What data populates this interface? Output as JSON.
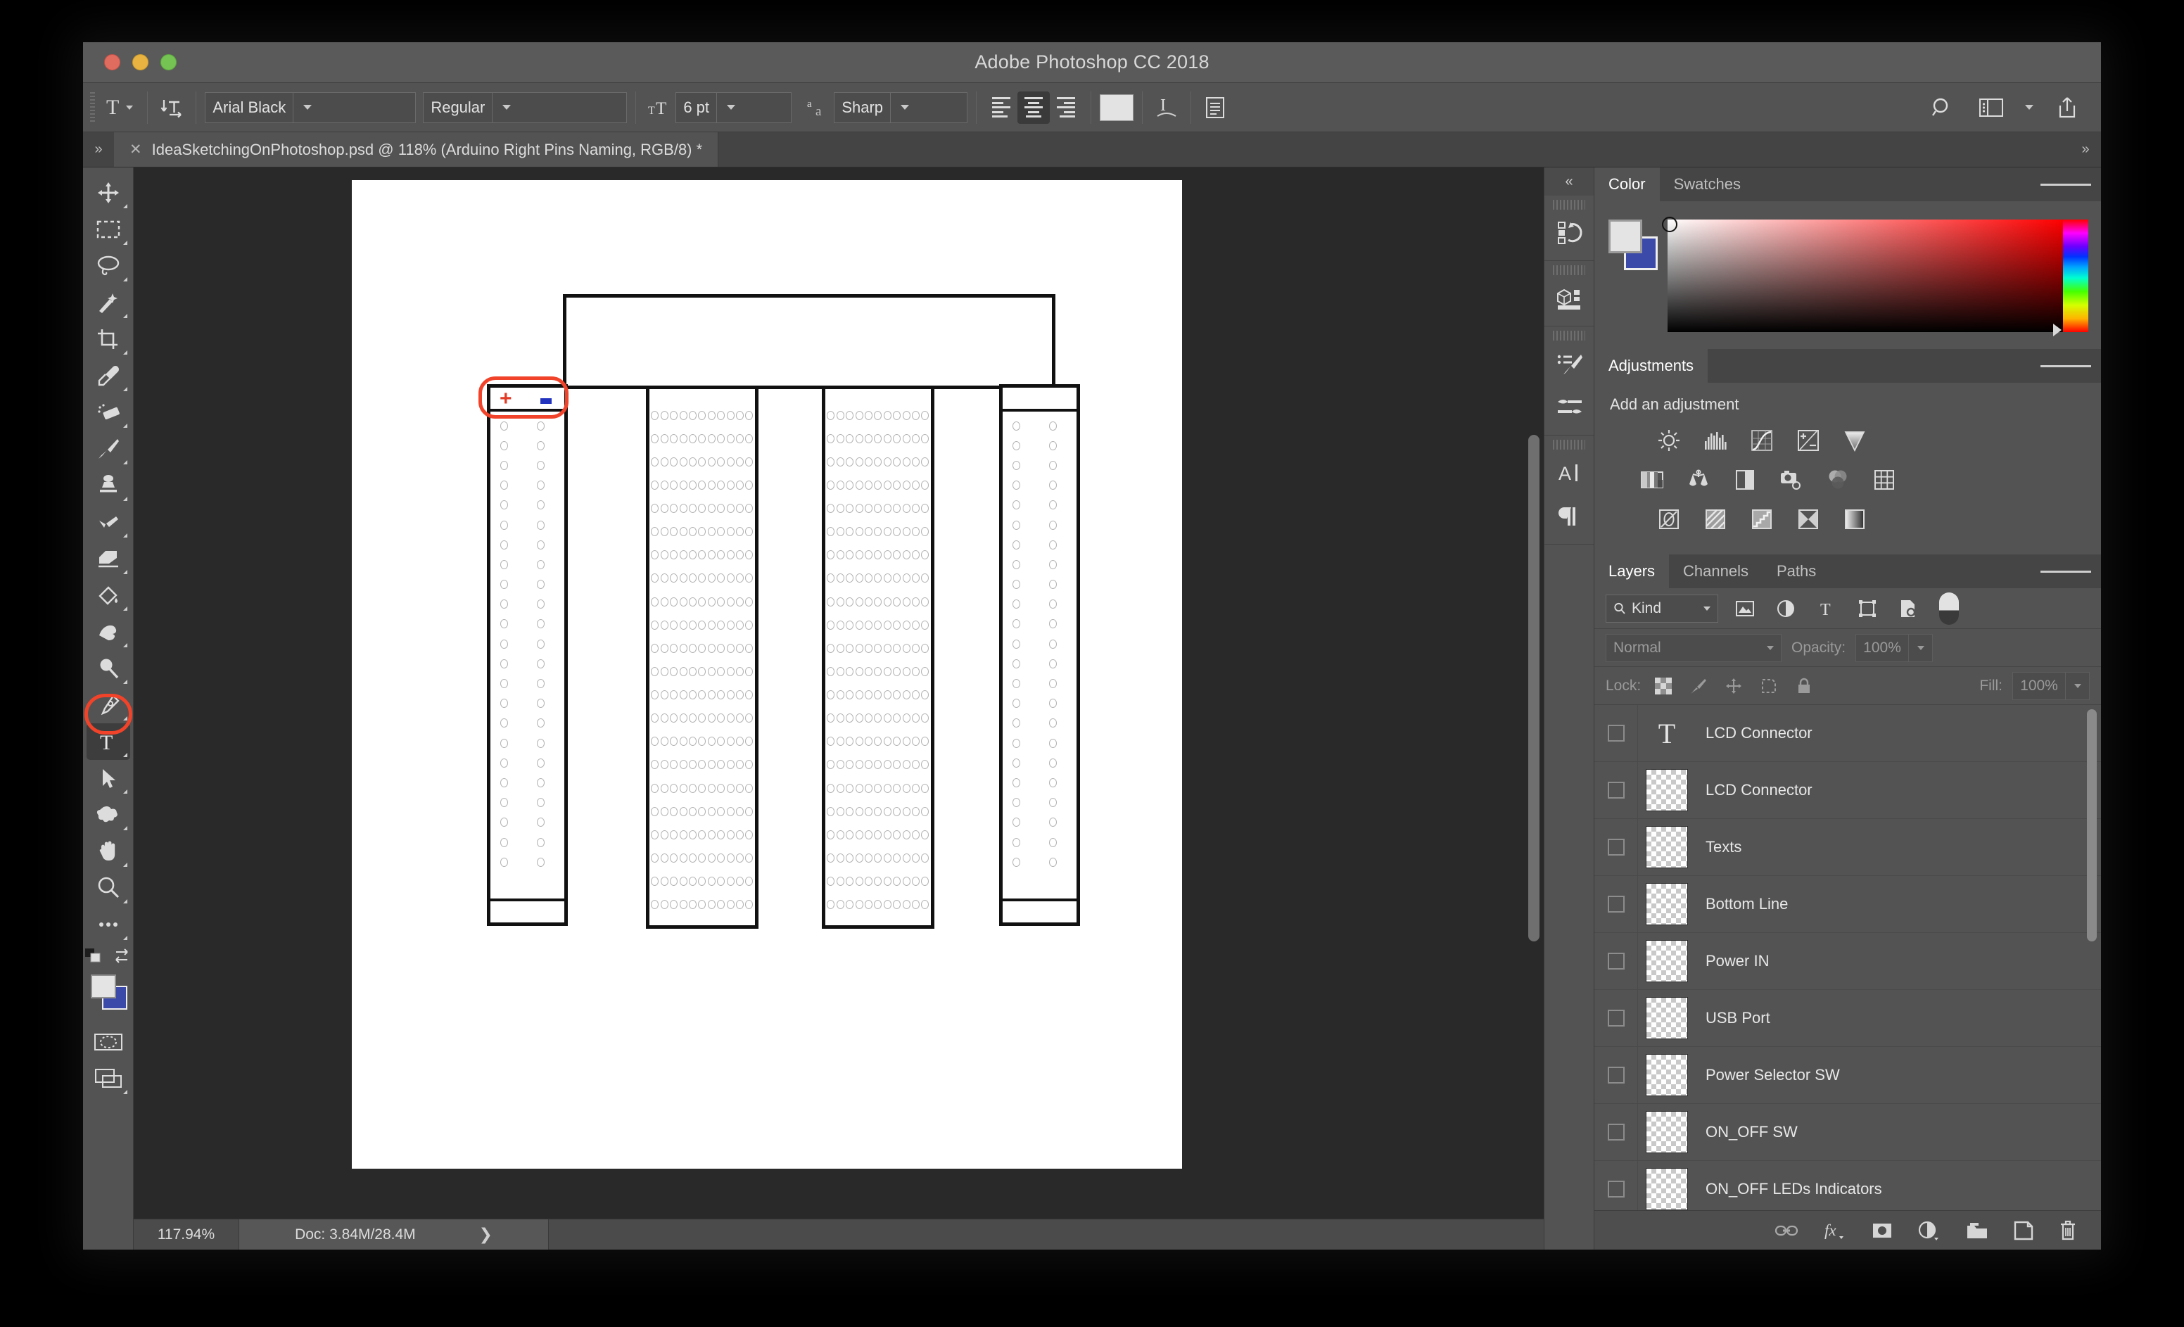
{
  "window": {
    "title": "Adobe Photoshop CC 2018",
    "traffic_lights": [
      "close",
      "minimize",
      "zoom"
    ]
  },
  "options_bar": {
    "tool_preset_icon": "text-tool-icon",
    "orientation_icon": "toggle-text-orientation-icon",
    "font_family": "Arial Black",
    "font_style": "Regular",
    "size_icon": "font-size-icon",
    "font_size": "6 pt",
    "antialias_icon": "anti-alias-icon",
    "antialias": "Sharp",
    "align_left_icon": "align-left-icon",
    "align_center_icon": "align-center-icon",
    "align_right_icon": "align-right-icon",
    "align_active": "center",
    "color_swatch": "#e3e3e3",
    "warp_icon": "warp-text-icon",
    "panel_icon": "character-paragraph-panel-icon",
    "search_icon": "search-icon",
    "workspace_icon": "workspace-switcher-icon",
    "workspace_caret_icon": "chevron-down-icon",
    "share_icon": "share-icon"
  },
  "tab_bar": {
    "collapse_icon": "expand-arrows-icon",
    "close_icon": "close-icon",
    "document_title": "IdeaSketchingOnPhotoshop.psd @ 118% (Arduino Right Pins Naming, RGB/8) *",
    "right_collapse_icon": "expand-arrows-icon"
  },
  "tools": [
    {
      "name": "move-tool",
      "icon": "move-icon",
      "selected": false
    },
    {
      "name": "rectangular-marquee-tool",
      "icon": "marquee-icon",
      "selected": false
    },
    {
      "name": "lasso-tool",
      "icon": "lasso-icon",
      "selected": false
    },
    {
      "name": "quick-selection-tool",
      "icon": "magic-wand-icon",
      "selected": false
    },
    {
      "name": "crop-tool",
      "icon": "crop-icon",
      "selected": false
    },
    {
      "name": "eyedropper-tool",
      "icon": "eyedropper-icon",
      "selected": false
    },
    {
      "name": "spot-healing-brush-tool",
      "icon": "healing-brush-icon",
      "selected": false
    },
    {
      "name": "brush-tool",
      "icon": "brush-icon",
      "selected": false
    },
    {
      "name": "clone-stamp-tool",
      "icon": "clone-stamp-icon",
      "selected": false
    },
    {
      "name": "history-brush-tool",
      "icon": "history-brush-icon",
      "selected": false
    },
    {
      "name": "eraser-tool",
      "icon": "eraser-icon",
      "selected": false
    },
    {
      "name": "gradient-tool",
      "icon": "paint-bucket-icon",
      "selected": false
    },
    {
      "name": "blur-tool",
      "icon": "blur-finger-icon",
      "selected": false
    },
    {
      "name": "dodge-tool",
      "icon": "dodge-icon",
      "selected": false
    },
    {
      "name": "pen-tool",
      "icon": "pen-icon",
      "selected": false
    },
    {
      "name": "type-tool",
      "icon": "text-tool-icon",
      "selected": true
    },
    {
      "name": "path-selection-tool",
      "icon": "path-arrow-icon",
      "selected": false
    },
    {
      "name": "shape-tool",
      "icon": "custom-shape-icon",
      "selected": false
    },
    {
      "name": "hand-tool",
      "icon": "hand-icon",
      "selected": false
    },
    {
      "name": "zoom-tool",
      "icon": "magnifier-icon",
      "selected": false
    },
    {
      "name": "edit-toolbar-button",
      "icon": "ellipsis-icon",
      "selected": false
    }
  ],
  "tool_footer": {
    "default_colors_icon": "default-colors-icon",
    "swap_colors_icon": "swap-colors-icon",
    "foreground_color": "#e4e4e4",
    "background_color": "#3b49a8",
    "quick_mask_icon": "quick-mask-icon",
    "screen_mode_icon": "screen-mode-icon"
  },
  "canvas": {
    "drawing": "arduino-breadboard-sketch",
    "plus_label": "+",
    "minus_label": "-",
    "highlight_color": "#f0432a",
    "plus_color": "#e23b26",
    "minus_color": "#2233c0",
    "vertical_scrollbar": "canvas-vertical-scrollbar",
    "horizontal_scrollbar": "canvas-horizontal-scrollbar"
  },
  "status_bar": {
    "zoom": "117.94%",
    "doc_info": "Doc: 3.84M/28.4M",
    "expand_icon": "chevron-right-icon"
  },
  "dock_rail": {
    "collapse_icon": "double-chevron-left-icon",
    "groups": [
      {
        "icons": [
          {
            "name": "history-panel-icon"
          }
        ]
      },
      {
        "icons": [
          {
            "name": "3d-panel-icon"
          }
        ]
      },
      {
        "icons": [
          {
            "name": "brush-presets-panel-icon"
          },
          {
            "name": "brush-settings-panel-icon"
          }
        ]
      },
      {
        "icons": [
          {
            "name": "character-panel-icon"
          },
          {
            "name": "paragraph-panel-icon"
          }
        ]
      }
    ]
  },
  "color_panel": {
    "tabs": [
      {
        "label": "Color",
        "active": true
      },
      {
        "label": "Swatches",
        "active": false
      }
    ],
    "menu_icon": "panel-menu-icon",
    "foreground_color": "#e4e4e4",
    "background_color": "#3b49a8",
    "picker_icon": "color-field",
    "hue_icon": "hue-slider"
  },
  "adjustments_panel": {
    "tabs": [
      {
        "label": "Adjustments",
        "active": true
      }
    ],
    "menu_icon": "panel-menu-icon",
    "heading": "Add an adjustment",
    "rows": [
      [
        "brightness-contrast-icon",
        "levels-icon",
        "curves-icon",
        "exposure-icon",
        "vibrance-icon"
      ],
      [
        "hue-saturation-icon",
        "color-balance-icon",
        "black-white-icon",
        "photo-filter-icon",
        "channel-mixer-icon",
        "color-lookup-icon"
      ],
      [
        "invert-icon",
        "posterize-icon",
        "threshold-icon",
        "gradient-map-icon",
        "selective-color-icon"
      ]
    ]
  },
  "layers_panel": {
    "tabs": [
      {
        "label": "Layers",
        "active": true
      },
      {
        "label": "Channels",
        "active": false
      },
      {
        "label": "Paths",
        "active": false
      }
    ],
    "menu_icon": "panel-menu-icon",
    "filter": {
      "kind_label": "Kind",
      "search_icon": "search-icon",
      "caret_icon": "chevron-down-icon",
      "type_filters": [
        "filter-pixel-layers-icon",
        "filter-adjustment-layers-icon",
        "filter-type-layers-icon",
        "filter-shape-layers-icon",
        "filter-smart-object-icon"
      ],
      "toggle_icon": "filter-toggle-switch"
    },
    "blend_mode": "Normal",
    "blend_caret_icon": "chevron-down-icon",
    "opacity_label": "Opacity:",
    "opacity_value": "100%",
    "opacity_caret_icon": "chevron-down-icon",
    "lock_label": "Lock:",
    "lock_icons": [
      "lock-transparent-pixels-icon",
      "lock-image-pixels-icon",
      "lock-position-icon",
      "lock-artboard-nesting-icon",
      "lock-all-icon"
    ],
    "fill_label": "Fill:",
    "fill_value": "100%",
    "fill_caret_icon": "chevron-down-icon",
    "layers": [
      {
        "name": "LCD Connector",
        "thumb": "type-layer-thumb",
        "visible": false
      },
      {
        "name": "LCD Connector",
        "thumb": "pixel-layer-thumb",
        "visible": false
      },
      {
        "name": "Texts",
        "thumb": "pixel-layer-thumb",
        "visible": false
      },
      {
        "name": "Bottom Line",
        "thumb": "pixel-layer-thumb",
        "visible": false
      },
      {
        "name": "Power IN",
        "thumb": "pixel-layer-thumb",
        "visible": false
      },
      {
        "name": "USB Port",
        "thumb": "pixel-layer-thumb",
        "visible": false
      },
      {
        "name": "Power Selector SW",
        "thumb": "pixel-layer-thumb",
        "visible": false
      },
      {
        "name": "ON_OFF SW",
        "thumb": "pixel-layer-thumb",
        "visible": false
      },
      {
        "name": "ON_OFF LEDs Indicators",
        "thumb": "pixel-layer-thumb",
        "visible": false
      }
    ],
    "scrollbar": "layers-scrollbar",
    "footer_icons": [
      "link-layers-icon",
      "layer-style-fx-icon",
      "add-layer-mask-icon",
      "new-fill-adjustment-layer-icon",
      "new-group-icon",
      "new-layer-icon",
      "delete-layer-icon"
    ]
  }
}
